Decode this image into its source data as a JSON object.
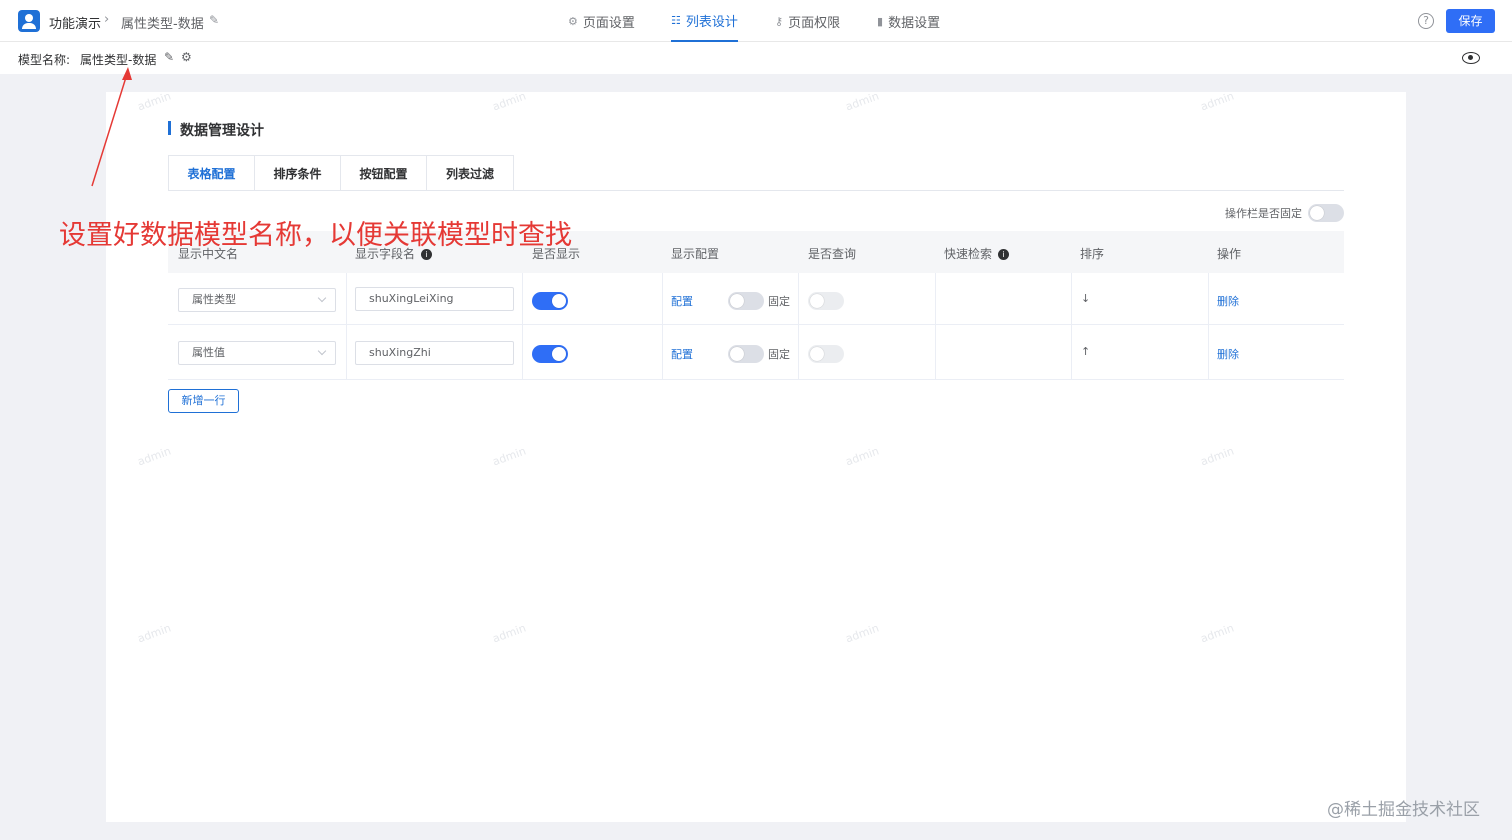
{
  "topbar": {
    "app_name": "功能演示",
    "breadcrumb_sep": "›",
    "page_name": "属性类型-数据",
    "edit_glyph": "✎",
    "tabs": [
      {
        "label": "页面设置",
        "icon": "gear-icon",
        "glyph": "⚙"
      },
      {
        "label": "列表设计",
        "icon": "list-icon",
        "glyph": "☷"
      },
      {
        "label": "页面权限",
        "icon": "key-icon",
        "glyph": "⚷"
      },
      {
        "label": "数据设置",
        "icon": "bar-chart-icon",
        "glyph": "▮"
      }
    ],
    "active_tab": "列表设计",
    "help_glyph": "?",
    "save_label": "保存"
  },
  "subbar": {
    "model_label": "模型名称:",
    "model_name": "属性类型-数据",
    "edit_glyph": "✎",
    "gear_glyph": "⚙"
  },
  "main": {
    "section_title": "数据管理设计",
    "subtabs": [
      "表格配置",
      "排序条件",
      "按钮配置",
      "列表过滤"
    ],
    "active_subtab": "表格配置",
    "fix_ops_label": "操作栏是否固定",
    "fix_ops_on": false,
    "columns": [
      "显示中文名",
      "显示字段名",
      "是否显示",
      "显示配置",
      "是否查询",
      "快速检索",
      "排序",
      "操作"
    ],
    "info_glyph": "i",
    "rows": [
      {
        "display_name": "属性类型",
        "field_name": "shuXingLeiXing",
        "visible": true,
        "config_link": "配置",
        "fixed_label": "固定",
        "fixed": false,
        "query": false,
        "sort_glyph": "↓",
        "delete_link": "删除"
      },
      {
        "display_name": "属性值",
        "field_name": "shuXingZhi",
        "visible": true,
        "config_link": "配置",
        "fixed_label": "固定",
        "fixed": false,
        "query": false,
        "sort_glyph": "↑",
        "delete_link": "删除"
      }
    ],
    "add_row_label": "新增一行"
  },
  "annotation": {
    "text": "设置好数据模型名称，以便关联模型时查找",
    "color": "#e53935"
  },
  "watermark": {
    "text": "admin",
    "footer": "@稀土掘金技术社区"
  },
  "colors": {
    "primary": "#1f70d6",
    "save_button": "#2f6ef6",
    "switch_on": "#2f6ef6",
    "background": "#f0f1f5"
  }
}
